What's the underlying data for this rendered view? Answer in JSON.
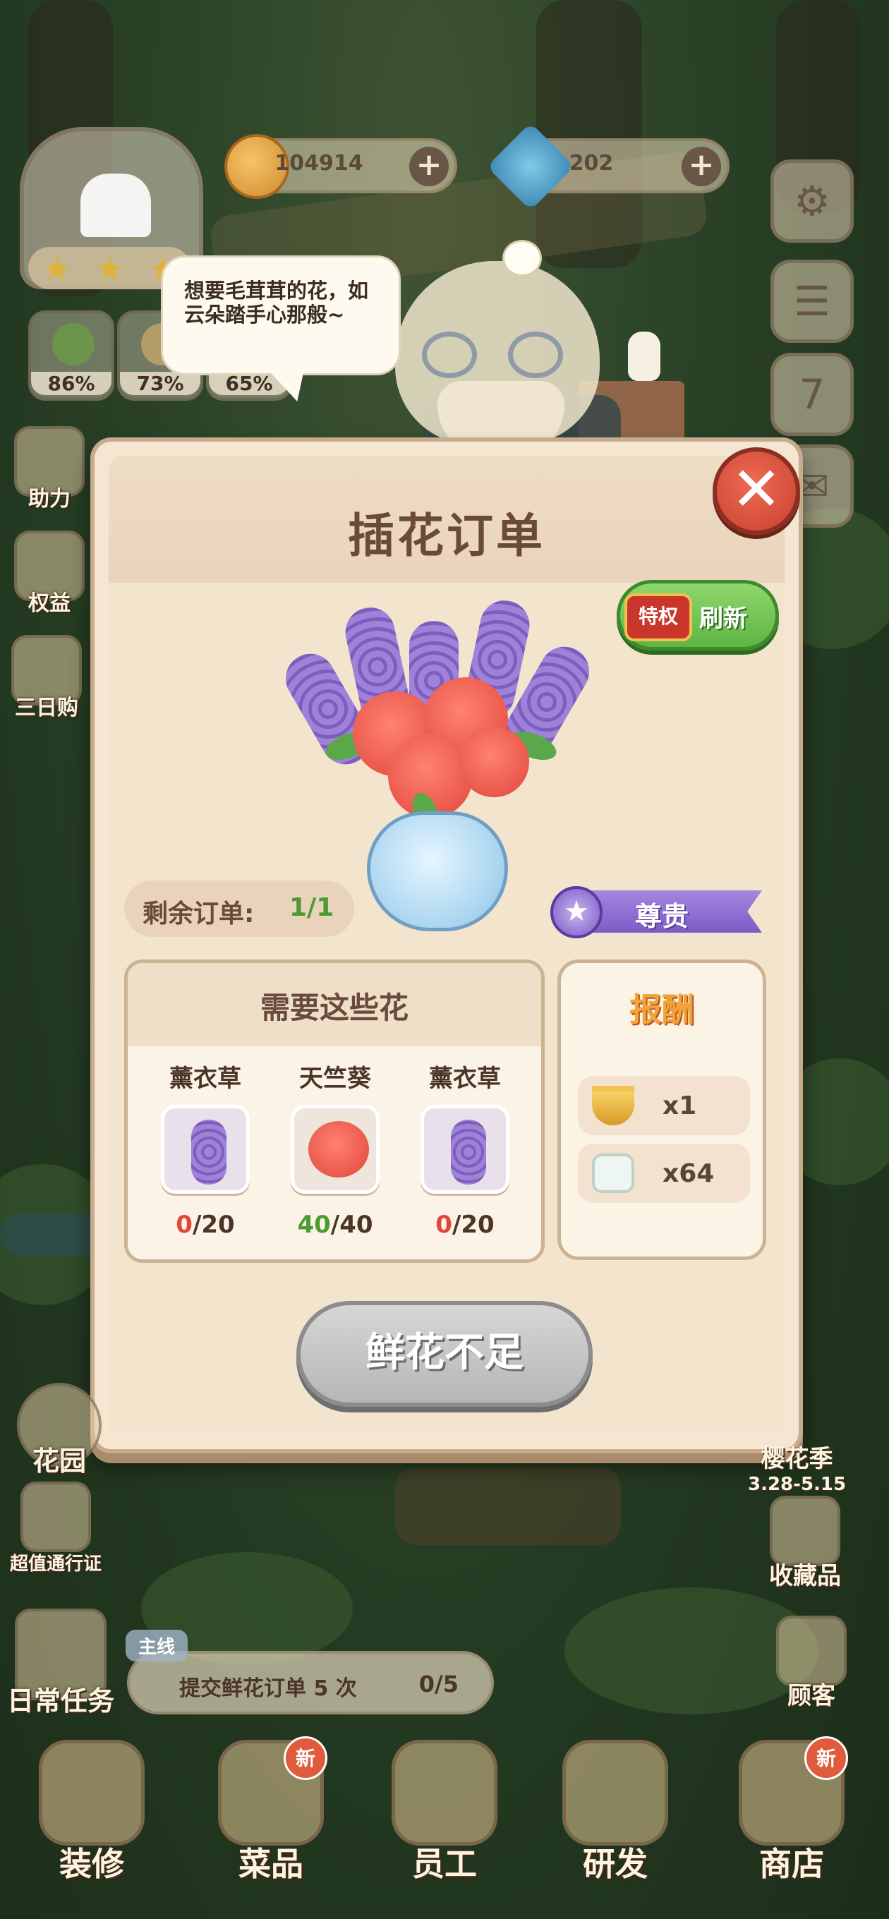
{
  "currency": {
    "coins": "104914",
    "gems": "202",
    "add_label": "+"
  },
  "stats": [
    "86%",
    "73%",
    "65%"
  ],
  "left_menu": {
    "help": "助力",
    "rights": "权益",
    "three_day": "三日购",
    "garden": "花园",
    "pass": "超值通行证",
    "daily_tasks": "日常任务"
  },
  "right_menu": {
    "calendar_day": "7",
    "season_name": "樱花季",
    "season_dates": "3.28-5.15",
    "collection": "收藏品",
    "customers": "顾客"
  },
  "npc": {
    "speech": "想要毛茸茸的花，如云朵踏手心那般~"
  },
  "order_panel": {
    "title": "插花订单",
    "close_label": "✕",
    "refresh": {
      "vip_label": "特权",
      "label": "刷新"
    },
    "remaining_label": "剩余订单:",
    "remaining_value": "1/1",
    "rank_label": "尊贵",
    "need_title": "需要这些花",
    "flowers": [
      {
        "name": "薰衣草",
        "have": "0",
        "total": "/20",
        "type": "lavender"
      },
      {
        "name": "天竺葵",
        "have": "40",
        "total": "/40",
        "type": "geranium"
      },
      {
        "name": "薰衣草",
        "have": "0",
        "total": "/20",
        "type": "lavender"
      }
    ],
    "reward_title": "报酬",
    "rewards": [
      {
        "icon": "golden-bowl-icon",
        "amount": "x1"
      },
      {
        "icon": "seed-jar-icon",
        "amount": "x64"
      }
    ],
    "submit_label": "鲜花不足"
  },
  "task": {
    "tag": "主线",
    "text": "提交鲜花订单 5 次",
    "progress": "0/5"
  },
  "bottom_nav": [
    {
      "label": "装修",
      "badge": ""
    },
    {
      "label": "菜品",
      "badge": "新"
    },
    {
      "label": "员工",
      "badge": ""
    },
    {
      "label": "研发",
      "badge": ""
    },
    {
      "label": "商店",
      "badge": "新"
    }
  ],
  "colors": {
    "panel_bg": "#f5e6d2",
    "title_brown": "#6a4b3b",
    "refresh_green": "#5fb443",
    "close_red": "#c8402e",
    "lacking_red": "#e0463a",
    "enough_green": "#4d9a33",
    "reward_orange": "#f2a43a",
    "rank_purple": "#7b5cc6"
  }
}
